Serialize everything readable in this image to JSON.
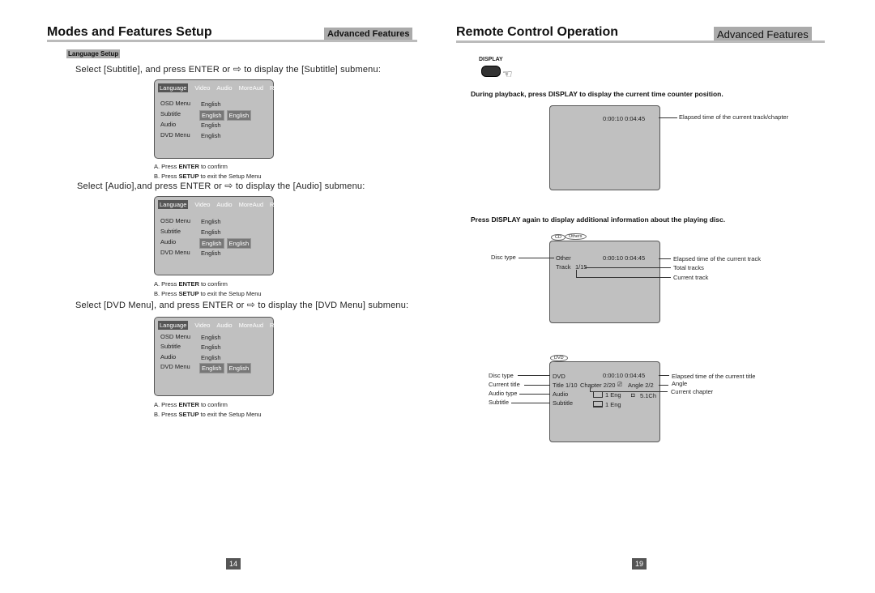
{
  "left": {
    "title": "Modes and Features Setup",
    "badge": "Advanced Features",
    "section": "Language Setup",
    "page_number": "14",
    "steps": [
      {
        "instruction_pre": "Select [Subtitle], and press ENTER or",
        "instruction_post": "to display the [Subtitle] submenu:"
      },
      {
        "instruction_pre": "Select [Audio],and press ENTER or",
        "instruction_post": "to display the [Audio] submenu:"
      },
      {
        "instruction_pre": "Select [DVD Menu], and press ENTER or",
        "instruction_post": "to display the [DVD Menu] submenu:"
      }
    ],
    "menu_tabs": [
      "Language",
      "Video",
      "Audio",
      "MoreAud",
      "Rating"
    ],
    "menu_rows": [
      "OSD Menu",
      "Subtitle",
      "Audio",
      "DVD Menu"
    ],
    "menu_value": "English",
    "notes": {
      "a_pre": "A.  Press ",
      "a_key": "ENTER",
      "a_post": " to confirm",
      "b_pre": "B.  Press ",
      "b_key": "SETUP",
      "b_post": " to exit the Setup Menu"
    }
  },
  "right": {
    "title": "Remote Control Operation",
    "badge": "Advanced Features",
    "display_button": "DISPLAY",
    "page_number": "19",
    "para1": "During playback, press DISPLAY to display the current time counter position.",
    "para2": "Press DISPLAY again to display additional information about the playing  disc.",
    "screen1": {
      "time": "0:00:10   0:04:45",
      "label": "Elapsed time of the current track/chapter"
    },
    "screen2": {
      "tabs": [
        "CD",
        "Others"
      ],
      "disc": "Other",
      "track": "Track",
      "track_val": "1/15",
      "time": "0:00:10   0:04:45",
      "labels": {
        "disc_type": "Disc type",
        "elapsed": "Elapsed time of the current track",
        "total": "Total tracks",
        "current": "Current track"
      }
    },
    "screen3": {
      "tab": "DVD",
      "disc": "DVD",
      "time": "0:00:10  0:04:45",
      "title": "Title 1/10",
      "chapter": "Chapter 2/20",
      "angle": "Angle  2/2",
      "audio": "Audio",
      "audio_val": "1 Eng",
      "channels": "5.1Ch",
      "subtitle": "Subtitle",
      "subtitle_val": "1 Eng",
      "labels": {
        "disc_type": "Disc type",
        "current_title": "Current title",
        "audio_type": "Audio type",
        "subtitle": "Subtitle",
        "elapsed": "Elapsed time of the current title",
        "angle": "Angle",
        "chapter": "Current chapter"
      }
    }
  }
}
